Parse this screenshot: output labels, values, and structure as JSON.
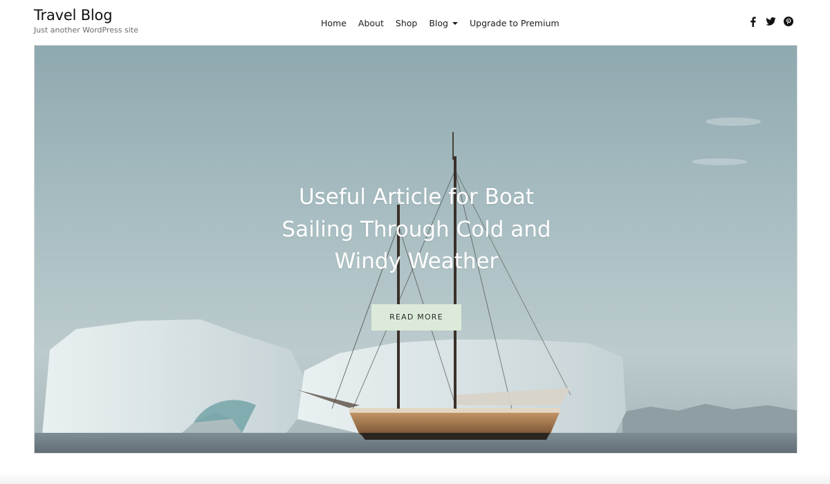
{
  "site": {
    "title": "Travel Blog",
    "tagline": "Just another WordPress site"
  },
  "nav": {
    "items": [
      {
        "label": "Home"
      },
      {
        "label": "About"
      },
      {
        "label": "Shop"
      },
      {
        "label": "Blog",
        "has_dropdown": true
      },
      {
        "label": "Upgrade to Premium"
      }
    ]
  },
  "social": {
    "icons": [
      "facebook-icon",
      "twitter-icon",
      "pinterest-icon"
    ]
  },
  "hero": {
    "title": "Useful Article for Boat Sailing Through Cold and Windy Weather",
    "button_label": "READ MORE",
    "button_color": "#dcebd9"
  }
}
